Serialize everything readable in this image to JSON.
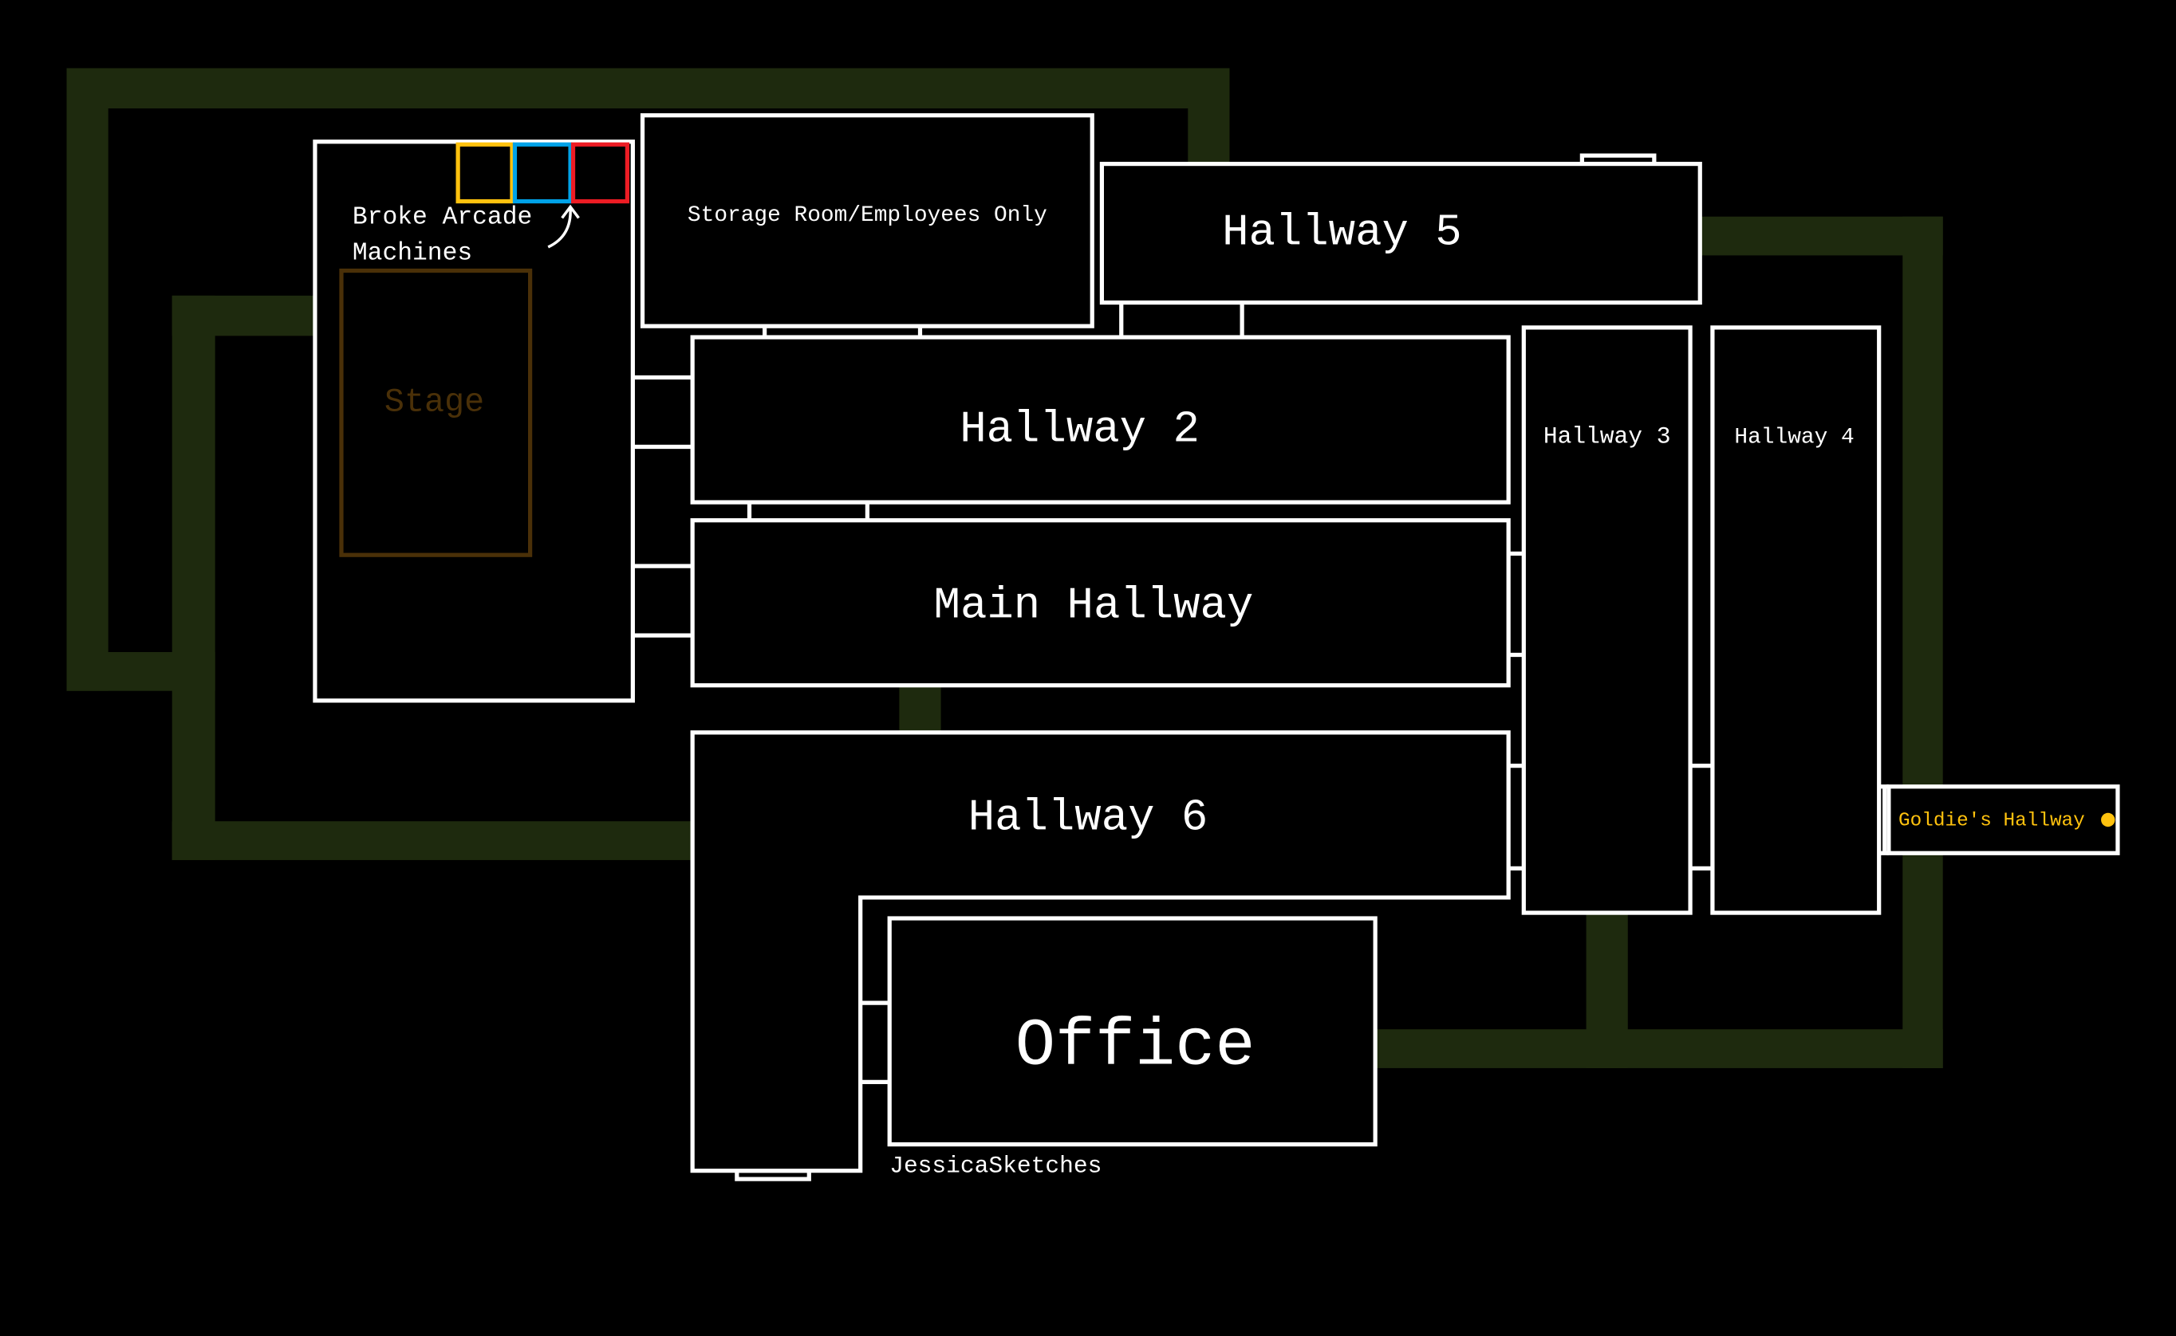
{
  "colors": {
    "background": "#000000",
    "path": "#1e2a0e",
    "walls": "#ffffff",
    "stage": "#4a3008",
    "arcade": [
      "#ffc20e",
      "#00a2e8",
      "#ed1c24"
    ],
    "goldie": "#ffc20e"
  },
  "rooms": {
    "arcade_label_line1": "Broke Arcade",
    "arcade_label_line2": "Machines",
    "stage": "Stage",
    "storage": "Storage Room/Employees Only",
    "hallway5": "Hallway 5",
    "hallway2": "Hallway 2",
    "main_hallway": "Main Hallway",
    "hallway6": "Hallway 6",
    "hallway3": "Hallway 3",
    "hallway4": "Hallway 4",
    "goldies_hallway": "Goldie's Hallway",
    "office": "Office"
  },
  "credit": "JessicaSketches"
}
